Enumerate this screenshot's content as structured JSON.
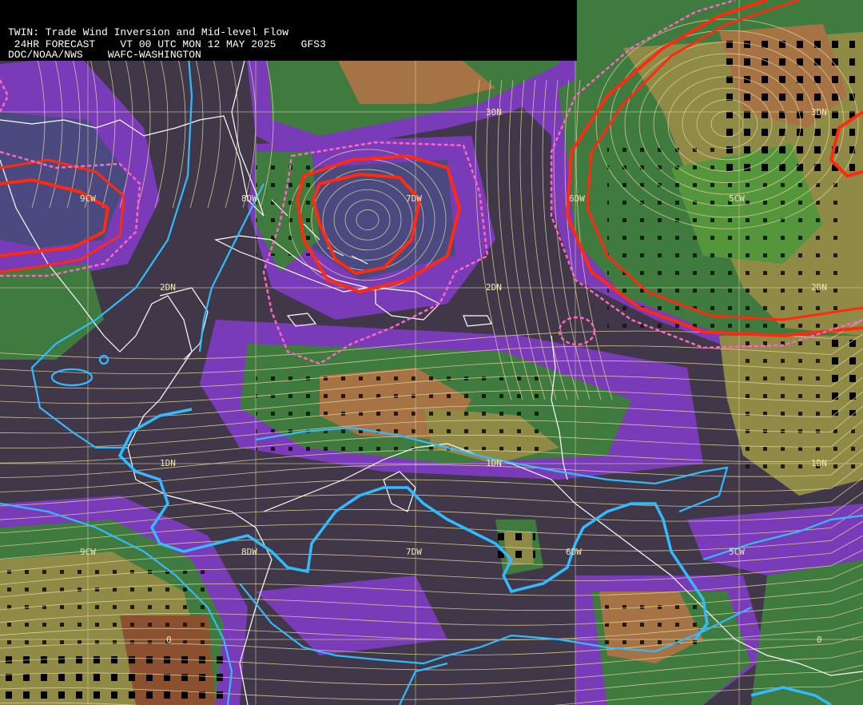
{
  "header": {
    "line1": "TWIN: Trade Wind Inversion and Mid-level Flow",
    "line2": " 24HR FORECAST    VT 00 UTC MON 12 MAY 2025    GFS3",
    "line3": "DOC/NOAA/NWS    WAFC-WASHINGTON"
  },
  "map": {
    "labels": [
      {
        "id": "lat-30n-center",
        "text": "30N"
      },
      {
        "id": "lat-30n-east",
        "text": "3DN"
      },
      {
        "id": "lon-90w-north",
        "text": "9CW"
      },
      {
        "id": "lon-80w-north",
        "text": "8DW"
      },
      {
        "id": "lon-70w-north",
        "text": "7DW"
      },
      {
        "id": "lon-60w-north",
        "text": "6DW"
      },
      {
        "id": "lon-50w-north",
        "text": "5CW"
      },
      {
        "id": "lat-20n-west",
        "text": "2DN"
      },
      {
        "id": "lat-20n-center",
        "text": "2DN"
      },
      {
        "id": "lat-20n-east",
        "text": "2DN"
      },
      {
        "id": "lat-10n-west",
        "text": "1DN"
      },
      {
        "id": "lat-10n-center",
        "text": "1DN"
      },
      {
        "id": "lat-10n-east",
        "text": "1DN"
      },
      {
        "id": "lon-90w-south",
        "text": "9CW"
      },
      {
        "id": "lon-80w-south",
        "text": "8DW"
      },
      {
        "id": "lon-70w-south",
        "text": "7DW"
      },
      {
        "id": "lon-60w-south",
        "text": "6DW"
      },
      {
        "id": "lon-50w-south",
        "text": "5CW"
      },
      {
        "id": "eq-west",
        "text": "0"
      },
      {
        "id": "eq-east",
        "text": "0"
      }
    ],
    "colors": {
      "background": "#403848",
      "purple": "#7a3bb8",
      "slate": "#4a4a80",
      "green_dark": "#3f7a3e",
      "green": "#55953b",
      "olive": "#8f8a45",
      "brown": "#a67444",
      "brown_dark": "#8a5030",
      "inversion_red": "#ff2a10",
      "inversion_pink": "#ff66c4",
      "convergence_cyan": "#33bbff",
      "streamline": "#e8d8a0",
      "graticule": "#d8d0a0",
      "coast": "#ffffff"
    }
  }
}
